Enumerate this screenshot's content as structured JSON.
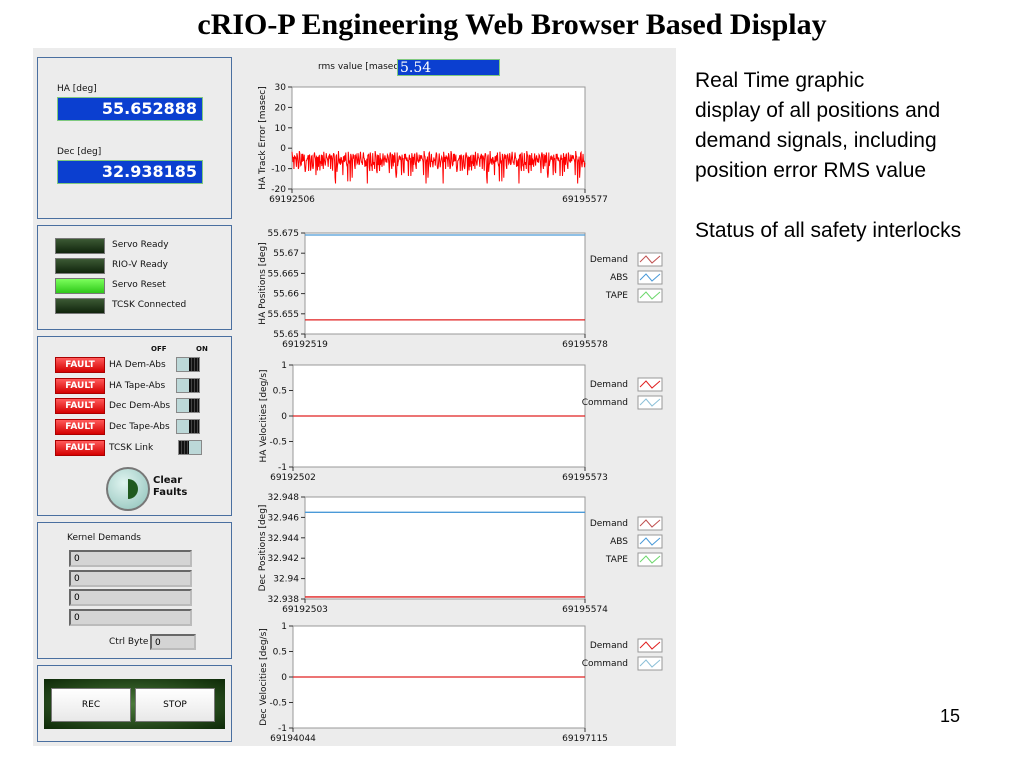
{
  "title": "cRIO-P Engineering Web Browser Based Display",
  "page_number": "15",
  "notes": [
    "Real Time graphic",
    "display of all positions and",
    "demand signals, including",
    "position error RMS value",
    "",
    "Status of all safety interlocks"
  ],
  "positions": {
    "ha_label": "HA [deg]",
    "ha_value": "55.652888",
    "dec_label": "Dec [deg]",
    "dec_value": "32.938185"
  },
  "status": [
    {
      "label": "Servo Ready",
      "on": false
    },
    {
      "label": "RIO-V Ready",
      "on": false
    },
    {
      "label": "Servo Reset",
      "on": true
    },
    {
      "label": "TCSK Connected",
      "on": false
    }
  ],
  "interlocks": {
    "off_label": "OFF",
    "on_label": "ON",
    "items": [
      {
        "badge": "FAULT",
        "label": "HA Dem-Abs",
        "switch": "on"
      },
      {
        "badge": "FAULT",
        "label": "HA Tape-Abs",
        "switch": "on"
      },
      {
        "badge": "FAULT",
        "label": "Dec Dem-Abs",
        "switch": "on"
      },
      {
        "badge": "FAULT",
        "label": "Dec Tape-Abs",
        "switch": "on"
      },
      {
        "badge": "FAULT",
        "label": "TCSK Link",
        "switch": "off"
      }
    ],
    "clear_label": "Clear Faults"
  },
  "kernel": {
    "label": "Kernel Demands",
    "values": [
      "0",
      "0",
      "0",
      "0"
    ],
    "ctrl_label": "Ctrl Byte",
    "ctrl_value": "0"
  },
  "buttons": {
    "rec": "REC",
    "stop": "STOP"
  },
  "rms": {
    "label": "rms value [masec]",
    "value": "5.54"
  },
  "colors": {
    "demand": "#e02020",
    "abs": "#4a9ad8",
    "tape": "#6cd86c",
    "indicator_blue": "#0b3fd0"
  },
  "chart_data": [
    {
      "type": "line",
      "ylabel": "HA Track Error [masec]",
      "ylim": [
        -20,
        30
      ],
      "yticks": [
        "30",
        "20",
        "10",
        "0",
        "-10",
        "-20"
      ],
      "xticks": [
        "69192506",
        "69195577"
      ],
      "series": [
        {
          "color": "#ff0000",
          "values": [
            3,
            -8,
            9,
            -5,
            7,
            -10,
            10,
            -6,
            4,
            -9,
            17,
            -7,
            8,
            -12,
            10,
            -4,
            6,
            -10,
            9,
            -8,
            5,
            -13,
            21,
            -7,
            10,
            -9,
            3,
            -17,
            8,
            -6,
            18,
            -10,
            7,
            -4,
            9,
            -11,
            10,
            -8,
            6,
            -9,
            12,
            -7,
            4,
            -12,
            9,
            -10,
            11,
            -6,
            7,
            -13,
            10,
            -9,
            8,
            -5,
            10,
            -11,
            6,
            -16,
            9,
            -7,
            12,
            -17
          ]
        }
      ],
      "legend": []
    },
    {
      "type": "line",
      "ylabel": "HA Positions [deg]",
      "ylim": [
        55.65,
        55.675
      ],
      "yticks": [
        "55.675",
        "55.67",
        "55.665",
        "55.66",
        "55.655",
        "55.65"
      ],
      "xticks": [
        "69192519",
        "69195578"
      ],
      "series": [
        {
          "name": "Demand",
          "color": "#e02020",
          "values": [
            55.6535,
            55.6535
          ]
        },
        {
          "name": "ABS",
          "color": "#4a9ad8",
          "values": [
            55.6745,
            55.6745
          ]
        }
      ],
      "legend": [
        {
          "name": "Demand",
          "color": "#c05050"
        },
        {
          "name": "ABS",
          "color": "#4a9ad8"
        },
        {
          "name": "TAPE",
          "color": "#6cd86c"
        }
      ]
    },
    {
      "type": "line",
      "ylabel": "HA  Velocities [deg/s]",
      "ylim": [
        -1,
        1
      ],
      "yticks": [
        "1",
        "0.5",
        "0",
        "-0.5",
        "-1"
      ],
      "xticks": [
        "69192502",
        "69195573"
      ],
      "series": [
        {
          "name": "Demand",
          "color": "#e02020",
          "values": [
            0,
            0
          ]
        }
      ],
      "legend": [
        {
          "name": "Demand",
          "color": "#e02020"
        },
        {
          "name": "Command",
          "color": "#8cc0d8"
        }
      ]
    },
    {
      "type": "line",
      "ylabel": "Dec  Positions [deg]",
      "ylim": [
        32.938,
        32.948
      ],
      "yticks": [
        "32.948",
        "32.946",
        "32.944",
        "32.942",
        "32.94",
        "32.938"
      ],
      "xticks": [
        "69192503",
        "69195574"
      ],
      "series": [
        {
          "name": "Demand",
          "color": "#e02020",
          "values": [
            32.9382,
            32.9382
          ]
        },
        {
          "name": "ABS",
          "color": "#4a9ad8",
          "values": [
            32.9465,
            32.9465
          ]
        }
      ],
      "legend": [
        {
          "name": "Demand",
          "color": "#c05050"
        },
        {
          "name": "ABS",
          "color": "#4a9ad8"
        },
        {
          "name": "TAPE",
          "color": "#6cd86c"
        }
      ]
    },
    {
      "type": "line",
      "ylabel": "Dec  Velocities [deg/s]",
      "ylim": [
        -1,
        1
      ],
      "yticks": [
        "1",
        "0.5",
        "0",
        "-0.5",
        "-1"
      ],
      "xticks": [
        "69194044",
        "69197115"
      ],
      "series": [
        {
          "name": "Demand",
          "color": "#e02020",
          "values": [
            0,
            0
          ]
        }
      ],
      "legend": [
        {
          "name": "Demand",
          "color": "#e02020"
        },
        {
          "name": "Command",
          "color": "#8cc0d8"
        }
      ]
    }
  ]
}
